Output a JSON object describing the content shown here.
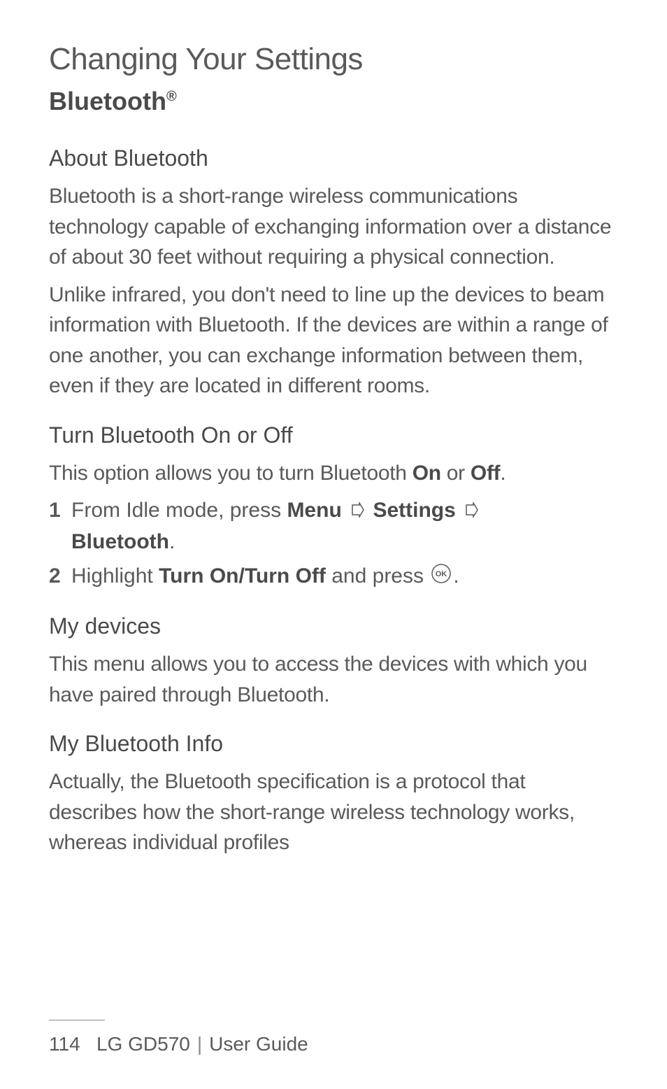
{
  "page_title": "Changing Your Settings",
  "section_title": "Bluetooth",
  "section_title_sup": "®",
  "subsections": {
    "about": {
      "title": "About Bluetooth",
      "p1": "Bluetooth is a short-range wireless communications technology capable of exchanging information over a distance of about 30 feet without requiring a physical connection.",
      "p2": "Unlike infrared, you don't need to line up the devices to beam information with Bluetooth. If the devices are within a range of one another, you can exchange information between them, even if they are located in different rooms."
    },
    "turn_onoff": {
      "title": "Turn Bluetooth On or Off",
      "intro_prefix": "This option allows you to turn Bluetooth ",
      "intro_on": "On",
      "intro_mid": " or ",
      "intro_off": "Off",
      "intro_suffix": ".",
      "step1": {
        "num": "1",
        "t1": "From Idle mode, press ",
        "menu": "Menu",
        "settings": "Settings",
        "bluetooth": "Bluetooth",
        "period": "."
      },
      "step2": {
        "num": "2",
        "t1": "Highlight ",
        "action": "Turn On/Turn Off",
        "t2": " and press ",
        "period": "."
      }
    },
    "my_devices": {
      "title": "My devices",
      "p1": "This menu allows you to access the devices with which you have paired through Bluetooth."
    },
    "my_bt_info": {
      "title": "My Bluetooth Info",
      "p1": "Actually, the Bluetooth specification is a protocol that describes how the short-range wireless technology works, whereas individual profiles"
    }
  },
  "footer": {
    "page_num": "114",
    "device": "LG GD570",
    "guide": "User Guide"
  },
  "icons": {
    "arrow": "arrow-right-outline",
    "ok": "ok-circle"
  }
}
